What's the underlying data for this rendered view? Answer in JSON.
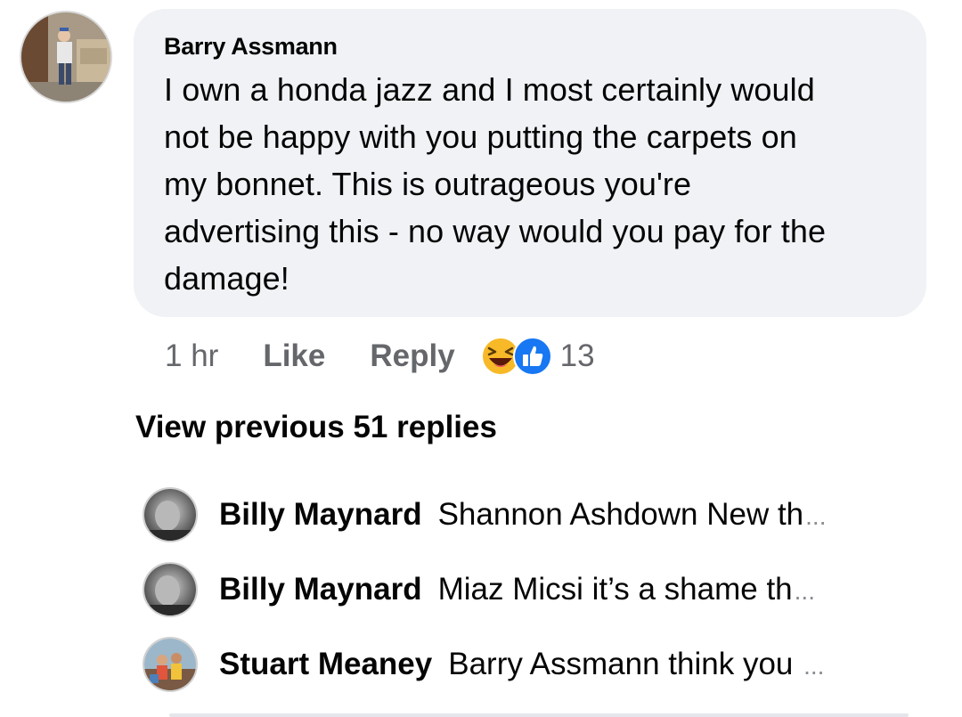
{
  "comment": {
    "author": "Barry Assmann",
    "text": "I own a honda jazz and I most certainly would not be happy with you putting the carpets on my bonnet. This is outrageous you're advertising this - no way would you pay for the damage!",
    "lines": [
      "I own a honda jazz and I most certainly would",
      "not be happy with you putting the carpets on",
      "my bonnet. This is outrageous you're",
      "advertising this - no way would you pay for the",
      "damage!"
    ],
    "time": "1 hr",
    "like_label": "Like",
    "reply_label": "Reply",
    "reaction_icons": [
      "haha-emoji-icon",
      "like-thumb-icon"
    ],
    "reaction_count": "13"
  },
  "view_previous_label": "View previous 51 replies",
  "replies": [
    {
      "name": "Billy Maynard",
      "text": "Shannon Ashdown New th",
      "ellipsis": "..."
    },
    {
      "name": "Billy Maynard",
      "text": "Miaz Micsi it’s a shame th",
      "ellipsis": "..."
    },
    {
      "name": "Stuart Meaney",
      "text": "Barry Assmann think you ",
      "ellipsis": "..."
    }
  ],
  "colors": {
    "bubble_bg": "#f0f2f5",
    "secondary_text": "#65676b",
    "like_blue": "#1877f2",
    "haha_yellow": "#f7b928"
  }
}
